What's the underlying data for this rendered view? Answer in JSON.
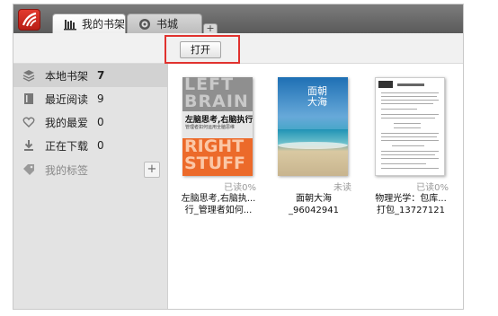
{
  "tabs": [
    {
      "label": "我的书架",
      "active": true,
      "icon": "bookshelf-icon"
    },
    {
      "label": "书城",
      "active": false,
      "icon": "compass-icon"
    }
  ],
  "tab_add_label": "+",
  "toolbar": {
    "open_label": "打开",
    "highlight_color": "#e0322e"
  },
  "sidebar": {
    "items": [
      {
        "label": "本地书架",
        "count": "7",
        "icon": "stack-icon",
        "selected": true
      },
      {
        "label": "最近阅读",
        "count": "9",
        "icon": "book-icon",
        "selected": false
      },
      {
        "label": "我的最爱",
        "count": "0",
        "icon": "heart-icon",
        "selected": false
      },
      {
        "label": "正在下载",
        "count": "0",
        "icon": "download-icon",
        "selected": false
      }
    ],
    "tags": {
      "label": "我的标签",
      "icon": "tag-icon",
      "add_label": "+"
    }
  },
  "books": [
    {
      "status": "已读0%",
      "title_line1": "左脑思考,右脑执...",
      "title_line2": "行_管理者如何...",
      "cover": {
        "top": "LEFT BRAIN",
        "band_title": "左脑思考,右脑执行",
        "band_sub": "管理者如何运用全脑思维",
        "bottom": "RIGHT STUFF",
        "accent": "#ec6a2a"
      }
    },
    {
      "status": "未读",
      "title_line1": "面朝大海_96042941",
      "title_line2": "",
      "cover": {
        "text": "面朝大海"
      }
    },
    {
      "status": "已读0%",
      "title_line1": "物理光学：包库...",
      "title_line2": "打包_13727121",
      "cover": {}
    }
  ]
}
